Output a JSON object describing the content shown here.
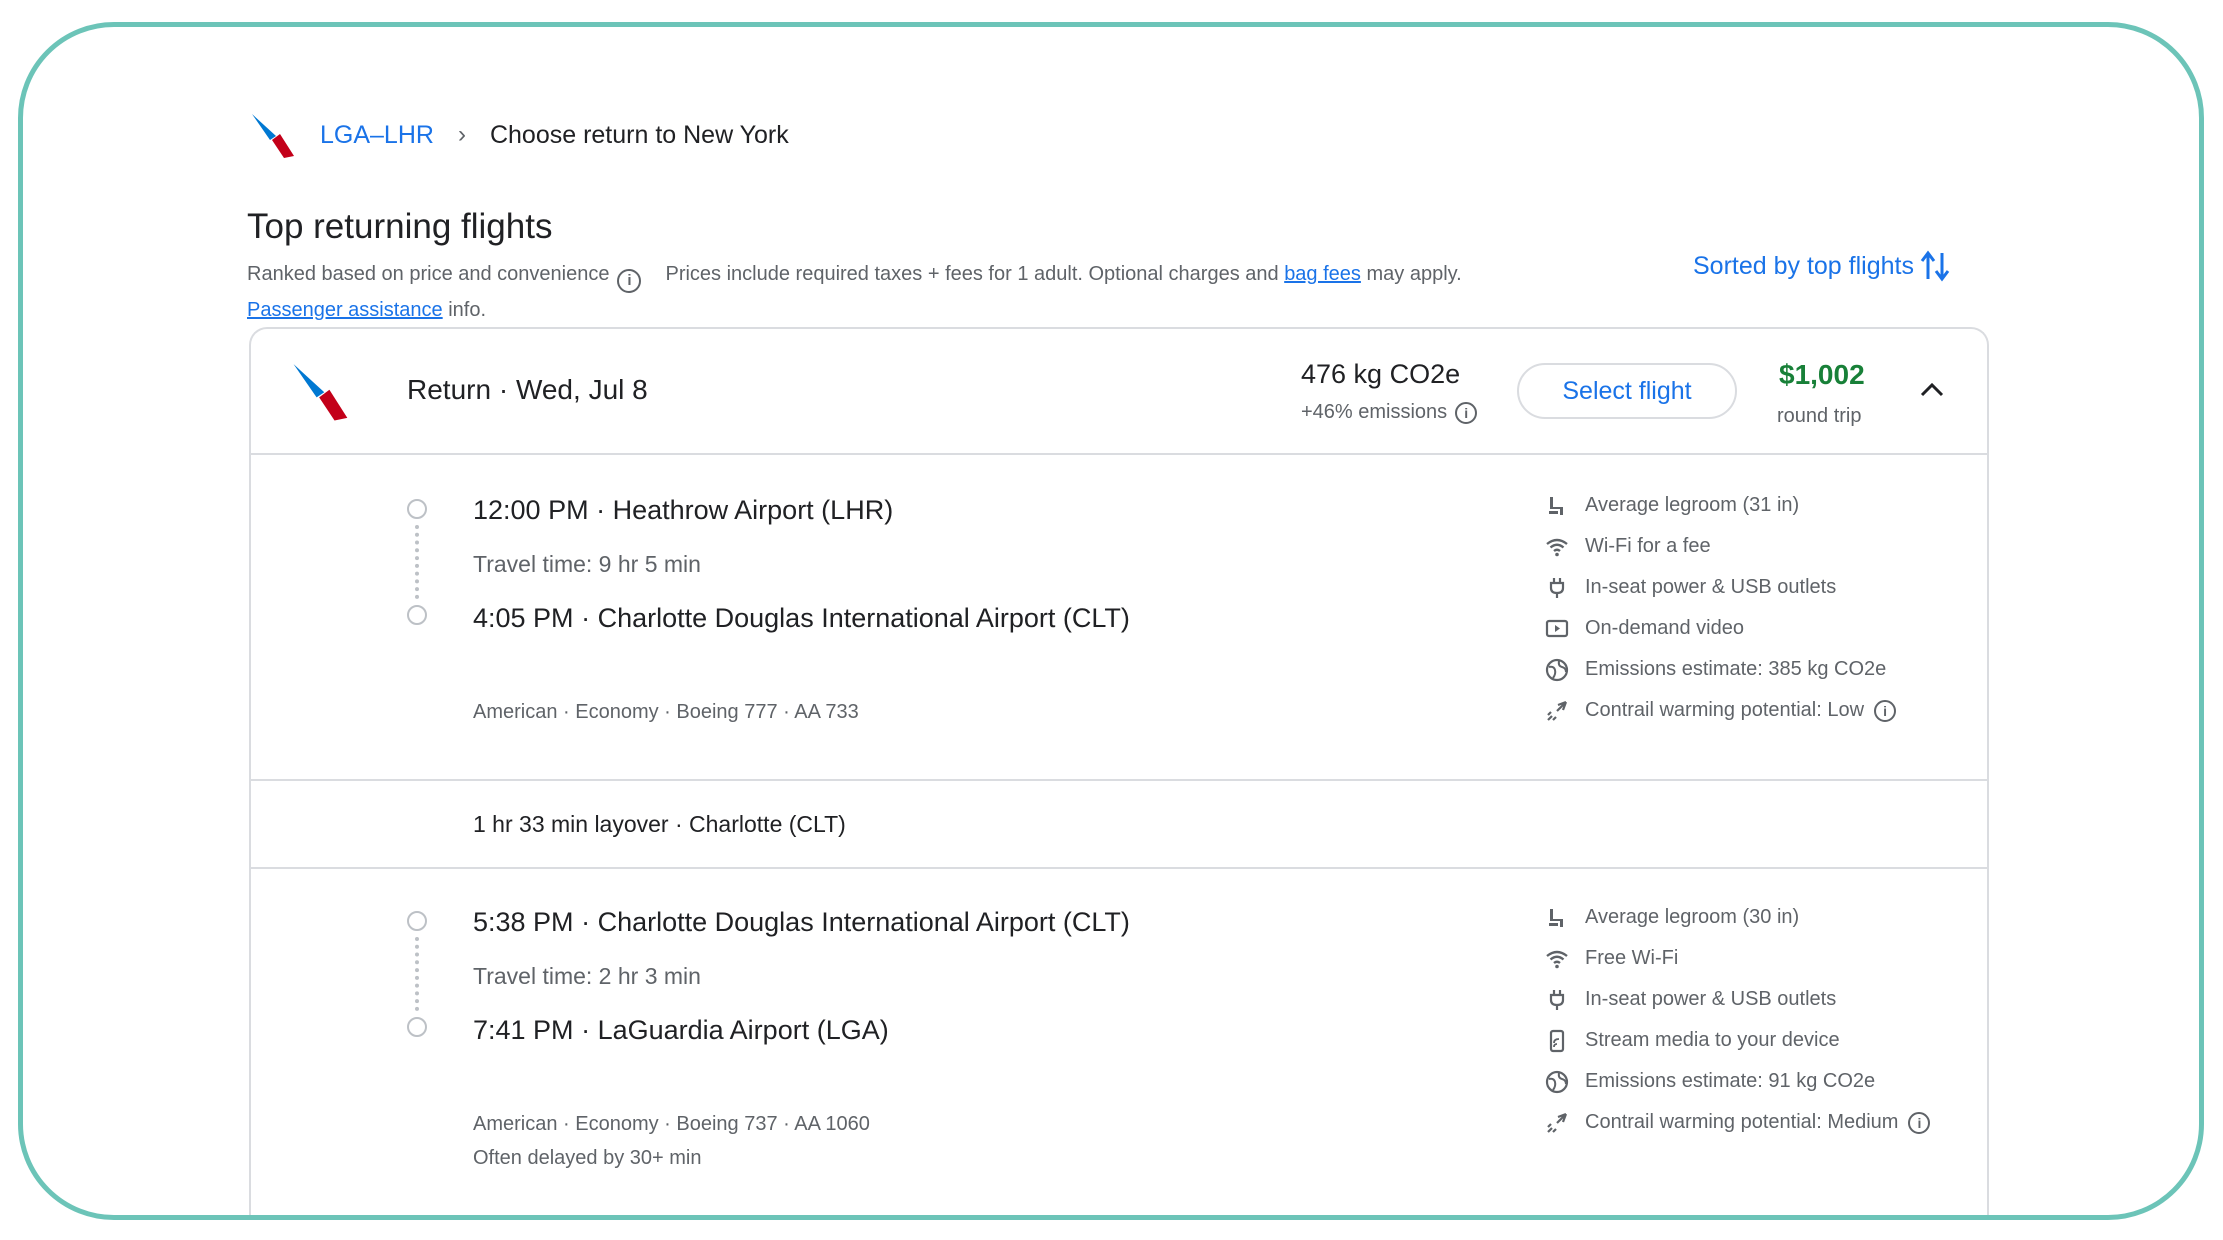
{
  "breadcrumb": {
    "route_link": "LGA–LHR",
    "current": "Choose return to New York"
  },
  "title": "Top returning flights",
  "subline": {
    "ranked": "Ranked based on price and convenience",
    "prices_pre": "Prices include required taxes + fees for 1 adult. Optional charges and",
    "bag_fees": "bag fees",
    "prices_post": "may apply.",
    "passenger_assistance": "Passenger assistance",
    "info_suffix": "info."
  },
  "sort": {
    "label": "Sorted by top flights"
  },
  "card": {
    "direction": "Return",
    "date": "Wed, Jul 8",
    "co2": "476 kg CO2e",
    "emissions": "+46% emissions",
    "select_label": "Select flight",
    "price": "$1,002",
    "price_note": "round trip",
    "segments": [
      {
        "depart_time": "12:00 PM",
        "depart_airport": "Heathrow Airport (LHR)",
        "travel_time": "Travel time: 9 hr 5 min",
        "arrive_time": "4:05 PM",
        "arrive_airport": "Charlotte Douglas International Airport (CLT)",
        "meta": "American · Economy · Boeing 777 · AA 733",
        "amenities": [
          {
            "icon": "seat-icon",
            "text": "Average legroom (31 in)"
          },
          {
            "icon": "wifi-icon",
            "text": "Wi-Fi for a fee"
          },
          {
            "icon": "power-plug-icon",
            "text": "In-seat power & USB outlets"
          },
          {
            "icon": "video-icon",
            "text": "On-demand video"
          },
          {
            "icon": "globe-icon",
            "text": "Emissions estimate: 385 kg CO2e"
          },
          {
            "icon": "contrail-icon",
            "text": "Contrail warming potential: Low"
          }
        ]
      },
      {
        "depart_time": "5:38 PM",
        "depart_airport": "Charlotte Douglas International Airport (CLT)",
        "travel_time": "Travel time: 2 hr 3 min",
        "arrive_time": "7:41 PM",
        "arrive_airport": "LaGuardia Airport (LGA)",
        "meta": "American · Economy · Boeing 737 · AA 1060",
        "delay": "Often delayed by 30+ min",
        "amenities": [
          {
            "icon": "seat-icon",
            "text": "Average legroom (30 in)"
          },
          {
            "icon": "wifi-icon",
            "text": "Free Wi-Fi"
          },
          {
            "icon": "power-plug-icon",
            "text": "In-seat power & USB outlets"
          },
          {
            "icon": "stream-device-icon",
            "text": "Stream media to your device"
          },
          {
            "icon": "globe-icon",
            "text": "Emissions estimate: 91 kg CO2e"
          },
          {
            "icon": "contrail-icon",
            "text": "Contrail warming potential: Medium"
          }
        ]
      }
    ],
    "layover": "1 hr 33 min layover · Charlotte (CLT)"
  },
  "colors": {
    "accent": "#1a73e8",
    "price": "#188038",
    "frame": "#6cc4b8",
    "logo_blue": "#0078d2",
    "logo_red": "#c30019"
  }
}
